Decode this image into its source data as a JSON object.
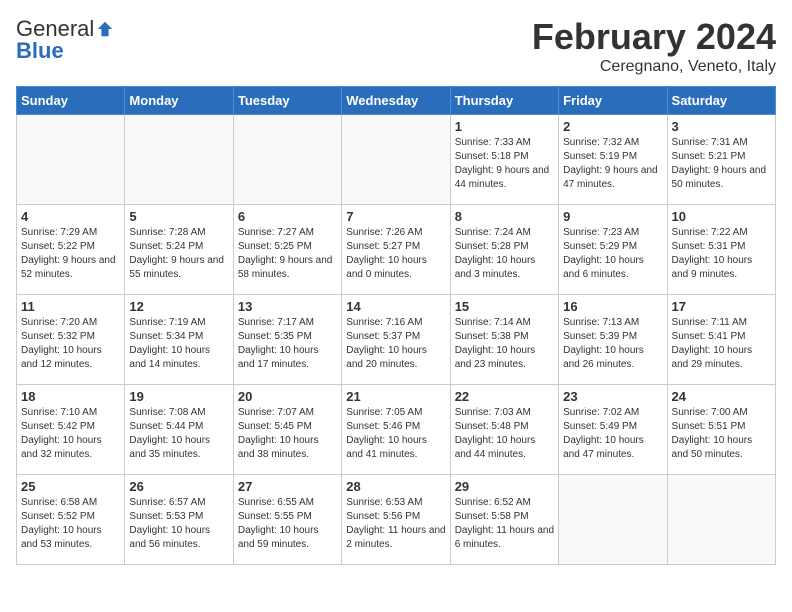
{
  "header": {
    "logo_general": "General",
    "logo_blue": "Blue",
    "title": "February 2024",
    "location": "Ceregnano, Veneto, Italy"
  },
  "weekdays": [
    "Sunday",
    "Monday",
    "Tuesday",
    "Wednesday",
    "Thursday",
    "Friday",
    "Saturday"
  ],
  "weeks": [
    [
      {
        "day": "",
        "info": ""
      },
      {
        "day": "",
        "info": ""
      },
      {
        "day": "",
        "info": ""
      },
      {
        "day": "",
        "info": ""
      },
      {
        "day": "1",
        "info": "Sunrise: 7:33 AM\nSunset: 5:18 PM\nDaylight: 9 hours\nand 44 minutes."
      },
      {
        "day": "2",
        "info": "Sunrise: 7:32 AM\nSunset: 5:19 PM\nDaylight: 9 hours\nand 47 minutes."
      },
      {
        "day": "3",
        "info": "Sunrise: 7:31 AM\nSunset: 5:21 PM\nDaylight: 9 hours\nand 50 minutes."
      }
    ],
    [
      {
        "day": "4",
        "info": "Sunrise: 7:29 AM\nSunset: 5:22 PM\nDaylight: 9 hours\nand 52 minutes."
      },
      {
        "day": "5",
        "info": "Sunrise: 7:28 AM\nSunset: 5:24 PM\nDaylight: 9 hours\nand 55 minutes."
      },
      {
        "day": "6",
        "info": "Sunrise: 7:27 AM\nSunset: 5:25 PM\nDaylight: 9 hours\nand 58 minutes."
      },
      {
        "day": "7",
        "info": "Sunrise: 7:26 AM\nSunset: 5:27 PM\nDaylight: 10 hours\nand 0 minutes."
      },
      {
        "day": "8",
        "info": "Sunrise: 7:24 AM\nSunset: 5:28 PM\nDaylight: 10 hours\nand 3 minutes."
      },
      {
        "day": "9",
        "info": "Sunrise: 7:23 AM\nSunset: 5:29 PM\nDaylight: 10 hours\nand 6 minutes."
      },
      {
        "day": "10",
        "info": "Sunrise: 7:22 AM\nSunset: 5:31 PM\nDaylight: 10 hours\nand 9 minutes."
      }
    ],
    [
      {
        "day": "11",
        "info": "Sunrise: 7:20 AM\nSunset: 5:32 PM\nDaylight: 10 hours\nand 12 minutes."
      },
      {
        "day": "12",
        "info": "Sunrise: 7:19 AM\nSunset: 5:34 PM\nDaylight: 10 hours\nand 14 minutes."
      },
      {
        "day": "13",
        "info": "Sunrise: 7:17 AM\nSunset: 5:35 PM\nDaylight: 10 hours\nand 17 minutes."
      },
      {
        "day": "14",
        "info": "Sunrise: 7:16 AM\nSunset: 5:37 PM\nDaylight: 10 hours\nand 20 minutes."
      },
      {
        "day": "15",
        "info": "Sunrise: 7:14 AM\nSunset: 5:38 PM\nDaylight: 10 hours\nand 23 minutes."
      },
      {
        "day": "16",
        "info": "Sunrise: 7:13 AM\nSunset: 5:39 PM\nDaylight: 10 hours\nand 26 minutes."
      },
      {
        "day": "17",
        "info": "Sunrise: 7:11 AM\nSunset: 5:41 PM\nDaylight: 10 hours\nand 29 minutes."
      }
    ],
    [
      {
        "day": "18",
        "info": "Sunrise: 7:10 AM\nSunset: 5:42 PM\nDaylight: 10 hours\nand 32 minutes."
      },
      {
        "day": "19",
        "info": "Sunrise: 7:08 AM\nSunset: 5:44 PM\nDaylight: 10 hours\nand 35 minutes."
      },
      {
        "day": "20",
        "info": "Sunrise: 7:07 AM\nSunset: 5:45 PM\nDaylight: 10 hours\nand 38 minutes."
      },
      {
        "day": "21",
        "info": "Sunrise: 7:05 AM\nSunset: 5:46 PM\nDaylight: 10 hours\nand 41 minutes."
      },
      {
        "day": "22",
        "info": "Sunrise: 7:03 AM\nSunset: 5:48 PM\nDaylight: 10 hours\nand 44 minutes."
      },
      {
        "day": "23",
        "info": "Sunrise: 7:02 AM\nSunset: 5:49 PM\nDaylight: 10 hours\nand 47 minutes."
      },
      {
        "day": "24",
        "info": "Sunrise: 7:00 AM\nSunset: 5:51 PM\nDaylight: 10 hours\nand 50 minutes."
      }
    ],
    [
      {
        "day": "25",
        "info": "Sunrise: 6:58 AM\nSunset: 5:52 PM\nDaylight: 10 hours\nand 53 minutes."
      },
      {
        "day": "26",
        "info": "Sunrise: 6:57 AM\nSunset: 5:53 PM\nDaylight: 10 hours\nand 56 minutes."
      },
      {
        "day": "27",
        "info": "Sunrise: 6:55 AM\nSunset: 5:55 PM\nDaylight: 10 hours\nand 59 minutes."
      },
      {
        "day": "28",
        "info": "Sunrise: 6:53 AM\nSunset: 5:56 PM\nDaylight: 11 hours\nand 2 minutes."
      },
      {
        "day": "29",
        "info": "Sunrise: 6:52 AM\nSunset: 5:58 PM\nDaylight: 11 hours\nand 6 minutes."
      },
      {
        "day": "",
        "info": ""
      },
      {
        "day": "",
        "info": ""
      }
    ]
  ]
}
